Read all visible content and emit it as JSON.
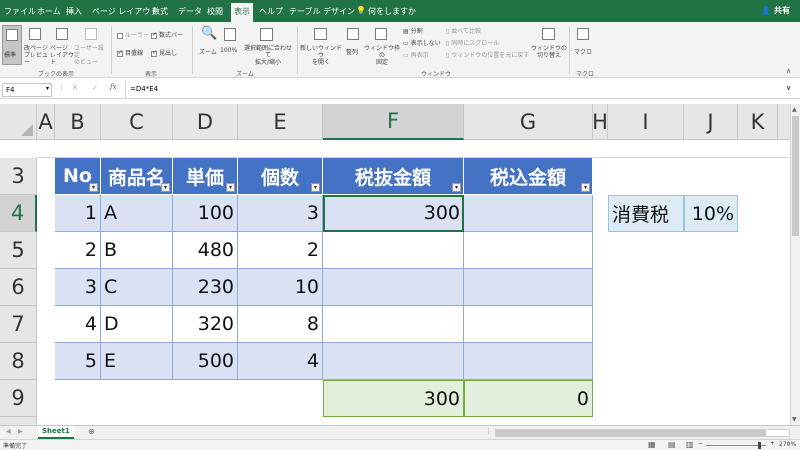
{
  "menu": {
    "tabs": [
      "ファイル",
      "ホーム",
      "挿入",
      "ページ レイアウト",
      "数式",
      "データ",
      "校閲",
      "表示",
      "ヘルプ",
      "テーブル デザイン"
    ],
    "active_tab": "表示",
    "tell_me": "何をしますか",
    "share": "共有"
  },
  "ribbon": {
    "workbook_views": {
      "normal": "標準",
      "page_break_preview": "改ページ\nプレビュー",
      "page_layout": "ページ\nレイアウト",
      "custom_views": "ユーザー設定\nのビュー",
      "group_label": "ブックの表示"
    },
    "show": {
      "ruler": "ルーラー",
      "gridlines": "目盛線",
      "formula_bar": "数式バー",
      "headings": "見出し",
      "group_label": "表示"
    },
    "zoom": {
      "zoom": "ズーム",
      "zoom_100": "100%",
      "zoom_selection": "選択範囲に合わせて\n拡大/縮小",
      "group_label": "ズーム"
    },
    "window": {
      "new_window": "新しいウィンドウ\nを開く",
      "arrange_all": "整列",
      "freeze_panes": "ウィンドウ枠の\n固定",
      "split": "分割",
      "hide": "表示しない",
      "unhide": "再表示",
      "view_side_by_side": "並べて比較",
      "synchronous_scrolling": "同時にスクロール",
      "reset_window_position": "ウィンドウの位置を元に戻す",
      "switch_windows": "ウィンドウの\n切り替え",
      "group_label": "ウィンドウ"
    },
    "macros": {
      "macros": "マクロ",
      "group_label": "マクロ"
    }
  },
  "formula_bar": {
    "name_box": "F4",
    "formula": "=D4*E4"
  },
  "columns": [
    "A",
    "B",
    "C",
    "D",
    "E",
    "F",
    "G",
    "H",
    "I",
    "J",
    "K"
  ],
  "selected_column": "F",
  "rows": [
    "3",
    "4",
    "5",
    "6",
    "7",
    "8",
    "9"
  ],
  "selected_row": "4",
  "table": {
    "headers": [
      "No",
      "商品名",
      "単価",
      "個数",
      "税抜金額",
      "税込金額"
    ],
    "rows": [
      [
        "1",
        "A",
        "100",
        "3",
        "300",
        ""
      ],
      [
        "2",
        "B",
        "480",
        "2",
        "",
        ""
      ],
      [
        "3",
        "C",
        "230",
        "10",
        "",
        ""
      ],
      [
        "4",
        "D",
        "320",
        "8",
        "",
        ""
      ],
      [
        "5",
        "E",
        "500",
        "4",
        "",
        ""
      ]
    ],
    "totals": [
      "300",
      "0"
    ]
  },
  "tax": {
    "label": "消費税",
    "rate": "10%"
  },
  "sheet_tabs": [
    "Sheet1"
  ],
  "status": {
    "ready": "準備完了",
    "zoom": "270%"
  },
  "colors": {
    "excel_green": "#217346",
    "table_header": "#4472c4",
    "table_band": "#d9e1f2",
    "total_fill": "#e2efda"
  }
}
